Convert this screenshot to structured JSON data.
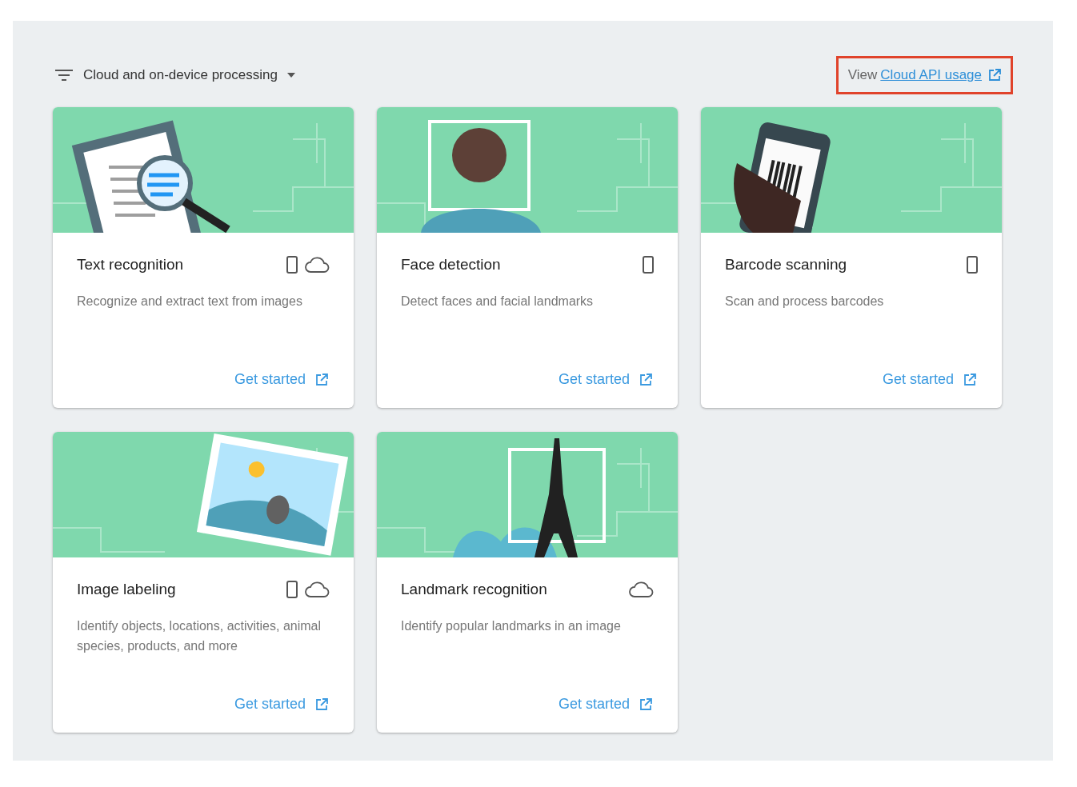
{
  "filter": {
    "label": "Cloud and on-device processing"
  },
  "usage_link": {
    "prefix": "View",
    "link": "Cloud API usage",
    "highlighted": true
  },
  "cards": [
    {
      "kind": "document",
      "title": "Text recognition",
      "on_device": true,
      "cloud": true,
      "description": "Recognize and extract text from images",
      "action": "Get started"
    },
    {
      "kind": "face",
      "title": "Face detection",
      "on_device": true,
      "cloud": false,
      "description": "Detect faces and facial landmarks",
      "action": "Get started"
    },
    {
      "kind": "phone",
      "title": "Barcode scanning",
      "on_device": true,
      "cloud": false,
      "description": "Scan and process barcodes",
      "action": "Get started"
    },
    {
      "kind": "photo",
      "title": "Image labeling",
      "on_device": true,
      "cloud": true,
      "description": "Identify objects, locations, activities, animal species, products, and more",
      "action": "Get started"
    },
    {
      "kind": "tower",
      "title": "Landmark recognition",
      "on_device": false,
      "cloud": true,
      "description": "Identify popular landmarks in an image",
      "action": "Get started"
    }
  ]
}
